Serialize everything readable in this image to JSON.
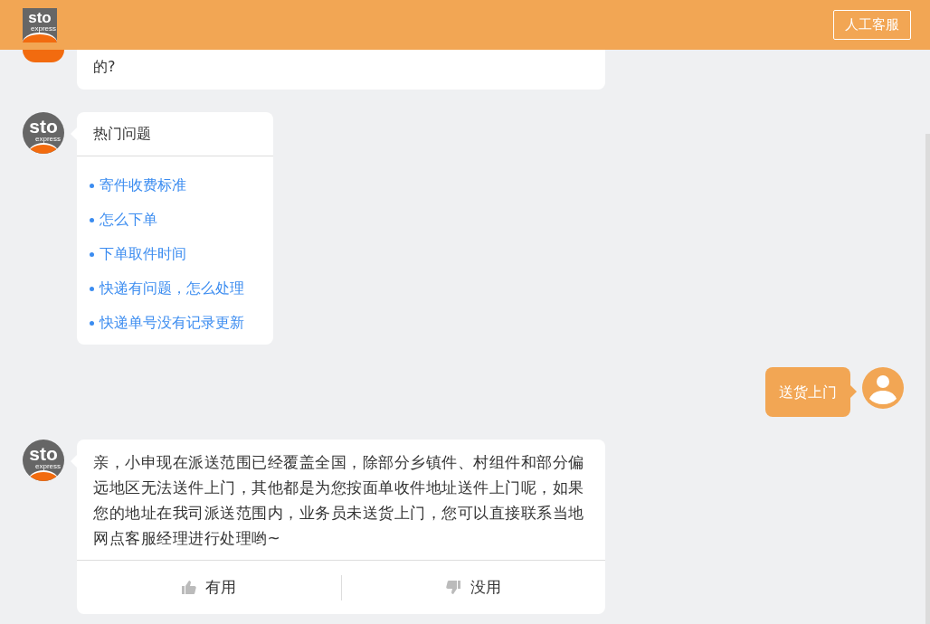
{
  "header": {
    "logo": {
      "brand": "sto",
      "tagline": "express"
    },
    "button": "人工客服"
  },
  "messages": [
    {
      "kind": "bot_text",
      "text": "的?"
    },
    {
      "kind": "hot_questions",
      "avatar": {
        "brand": "sto",
        "tagline": "express"
      },
      "title": "热门问题",
      "items": [
        "寄件收费标准",
        "怎么下单",
        "下单取件时间",
        "快递有问题，怎么处理",
        "快递单号没有记录更新"
      ]
    },
    {
      "kind": "user_text",
      "text": "送货上门"
    },
    {
      "kind": "bot_answer",
      "avatar": {
        "brand": "sto",
        "tagline": "express"
      },
      "text": "亲，小申现在派送范围已经覆盖全国，除部分乡镇件、村组件和部分偏远地区无法送件上门，其他都是为您按面单收件地址送件上门呢，如果您的地址在我司派送范围内，业务员未送货上门，您可以直接联系当地网点客服经理进行处理哟~",
      "feedback": [
        {
          "kind": "up",
          "label": "有用"
        },
        {
          "kind": "down",
          "label": "没用"
        }
      ]
    }
  ]
}
